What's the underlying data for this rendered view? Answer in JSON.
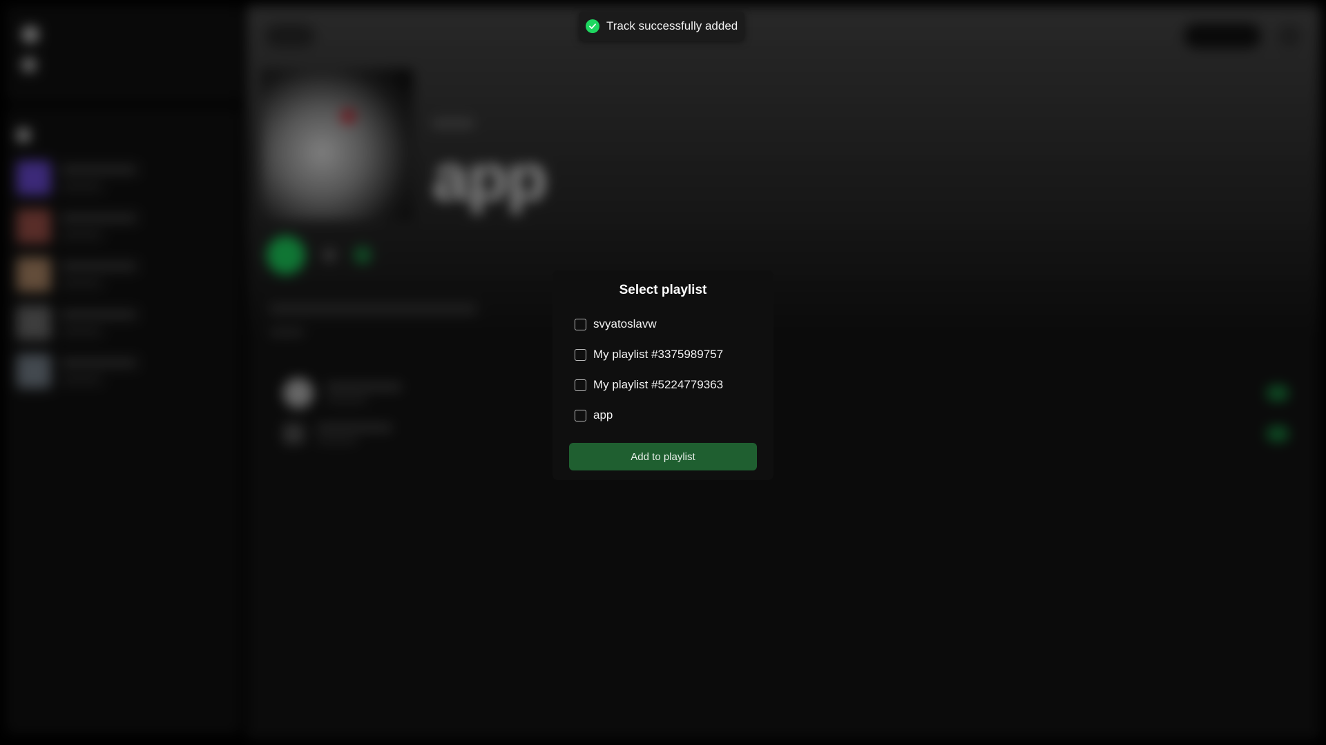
{
  "toast": {
    "message": "Track successfully added",
    "icon": "check-circle-icon",
    "icon_color": "#1ed760"
  },
  "modal": {
    "title": "Select playlist",
    "options": [
      {
        "label": "svyatoslavw",
        "checked": false
      },
      {
        "label": "My playlist #3375989757",
        "checked": false
      },
      {
        "label": "My playlist #5224779363",
        "checked": false
      },
      {
        "label": "app",
        "checked": false
      }
    ],
    "submit_label": "Add to playlist",
    "submit_color": "#1f5f30"
  },
  "background": {
    "playlist_title": "app"
  },
  "colors": {
    "accent": "#1ed760",
    "modal_bg": "#0f0f0f",
    "overlay_bg": "#000000"
  }
}
